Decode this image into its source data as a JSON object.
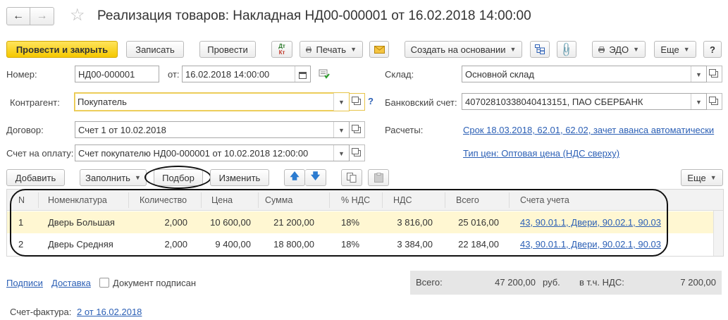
{
  "window": {
    "title": "Реализация товаров: Накладная НД00-000001 от 16.02.2018 14:00:00"
  },
  "toolbar": {
    "post_close": "Провести и закрыть",
    "save": "Записать",
    "post": "Провести",
    "dtkt_dt": "Дт",
    "dtkt_kt": "Кт",
    "print": "Печать",
    "create_based": "Создать на основании",
    "edo": "ЭДО",
    "more": "Еще"
  },
  "form": {
    "number_label": "Номер:",
    "number_value": "НД00-000001",
    "date_label": "от:",
    "date_value": "16.02.2018 14:00:00",
    "warehouse_label": "Склад:",
    "warehouse_value": "Основной склад",
    "counterparty_label": "Контрагент:",
    "counterparty_value": "Покупатель",
    "help": "?",
    "bank_label": "Банковский счет:",
    "bank_value": "40702810338040413151, ПАО СБЕРБАНК",
    "contract_label": "Договор:",
    "contract_value": "Счет 1 от 10.02.2018",
    "settlements_label": "Расчеты:",
    "settlements_link": "Срок 18.03.2018, 62.01, 62.02, зачет аванса автоматически",
    "invoice_label": "Счет на оплату:",
    "invoice_value": "Счет покупателю НД00-000001 от 10.02.2018 12:00:00",
    "price_type_link": "Тип цен: Оптовая цена (НДС сверху)"
  },
  "table_toolbar": {
    "add": "Добавить",
    "fill": "Заполнить",
    "pick": "Подбор",
    "change": "Изменить",
    "more": "Еще"
  },
  "table": {
    "headers": [
      "N",
      "Номенклатура",
      "Количество",
      "Цена",
      "Сумма",
      "% НДС",
      "НДС",
      "Всего",
      "Счета учета"
    ],
    "rows": [
      [
        "1",
        "Дверь Большая",
        "2,000",
        "10 600,00",
        "21 200,00",
        "18%",
        "3 816,00",
        "25 016,00",
        "43, 90.01.1, Двери, 90.02.1, 90.03"
      ],
      [
        "2",
        "Дверь Средняя",
        "2,000",
        "9 400,00",
        "18 800,00",
        "18%",
        "3 384,00",
        "22 184,00",
        "43, 90.01.1, Двери, 90.02.1, 90.03"
      ]
    ]
  },
  "footer": {
    "signatures": "Подписи",
    "delivery": "Доставка",
    "signed_label": "Документ подписан",
    "total_label": "Всего:",
    "total_value": "47 200,00",
    "currency": "руб.",
    "vat_label": "в т.ч. НДС:",
    "vat_value": "7 200,00",
    "invoice_doc_label": "Счет-фактура:",
    "invoice_doc_link": "2 от 16.02.2018"
  }
}
